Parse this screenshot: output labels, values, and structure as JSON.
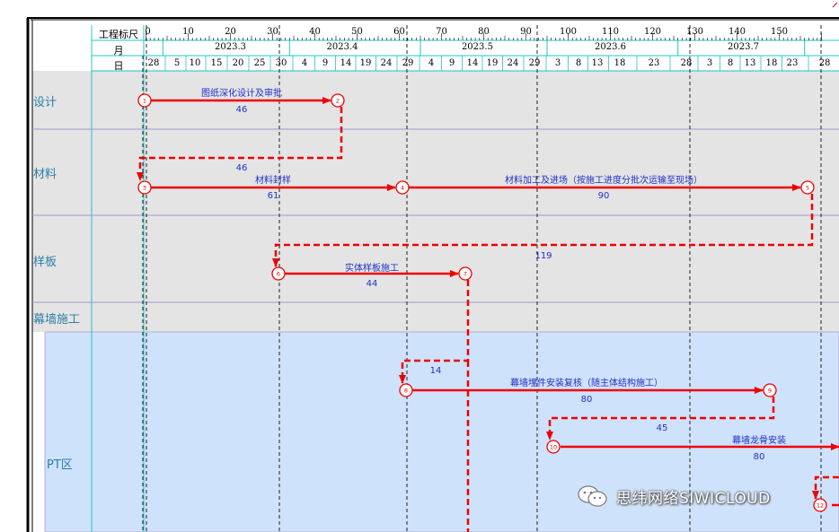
{
  "header": {
    "scale_label": "工程标尺",
    "month_label": "月",
    "day_label": "日"
  },
  "scale_ticks": [
    "0",
    "10",
    "20",
    "30",
    "40",
    "50",
    "60",
    "70",
    "80",
    "90",
    "100",
    "110",
    "120",
    "130",
    "140",
    "150"
  ],
  "months": [
    "2023.3",
    "2023.4",
    "2023.5",
    "2023.6",
    "2023.7"
  ],
  "days": [
    "28",
    "5",
    "10",
    "15",
    "20",
    "25",
    "30",
    "4",
    "9",
    "14",
    "19",
    "24",
    "29",
    "4",
    "9",
    "14",
    "19",
    "24",
    "29",
    "3",
    "8",
    "13",
    "18",
    "23",
    "28",
    "3",
    "8",
    "13",
    "18",
    "23",
    "28"
  ],
  "rows": {
    "design": "设计",
    "material": "材料",
    "sample": "样板",
    "curtain_wall": "幕墙施工",
    "pt_zone": "PT区"
  },
  "nodes": [
    "1",
    "2",
    "3",
    "4",
    "5",
    "6",
    "7",
    "8",
    "9",
    "10",
    "12"
  ],
  "tasks": [
    {
      "name": "图纸深化设计及审批",
      "duration": "46"
    },
    {
      "name": "材料封样",
      "duration": "61"
    },
    {
      "name": "材料加工及进场（按施工进度分批次运输至现场）",
      "duration": "90"
    },
    {
      "name": "实体样板施工",
      "duration": "44"
    },
    {
      "name": "幕墙埋件安装复核（随主体结构施工）",
      "duration": "80"
    },
    {
      "name": "幕墙龙骨安装",
      "duration": "80"
    }
  ],
  "link_durations": [
    "46",
    "119",
    "14",
    "45"
  ],
  "watermark": "思纬网络SIWICLOUD",
  "colors": {
    "arrow": "#ee0000",
    "label": "#2030c8",
    "row_title": "#2a7fa8",
    "grid_bg": "#e4e4e4",
    "pt_bg": "#cfe2fb",
    "grid_line": "#21c4c4"
  }
}
